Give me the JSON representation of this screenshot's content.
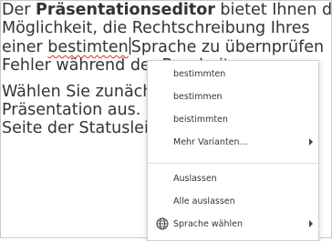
{
  "document": {
    "p1": {
      "l1_a": "Der ",
      "l1_bold": "Präsentationseditor",
      "l1_b": " bietet Ihnen die",
      "l2": "Möglichkeit, die Rechtschreibung Ihres",
      "l3_a": "einer ",
      "l3_misspelled": "bestimten",
      "l3_b": "Sprache zu übernprüfen",
      "l4": "Fehler während der Bearbeitung"
    },
    "p2": {
      "l1": "Wählen Sie zunächst die Sprache für",
      "l2": "Präsentation aus. Klicken Sie dazu",
      "l3": "Seite der Statusleiste"
    }
  },
  "context_menu": {
    "suggestions": [
      "bestimmten",
      "bestimmen",
      "beistimmten"
    ],
    "more_variants": "Mehr Varianten...",
    "ignore": "Auslassen",
    "ignore_all": "Alle auslassen",
    "language": "Sprache wählen"
  },
  "icons": {
    "submenu": "chevron-right-icon",
    "language": "globe-icon"
  },
  "colors": {
    "spellcheck_underline": "#d93025",
    "text": "#333333"
  }
}
